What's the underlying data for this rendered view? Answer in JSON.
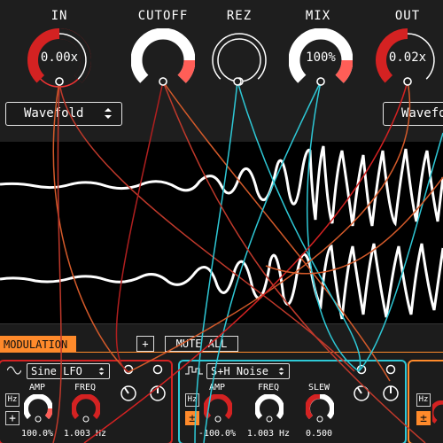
{
  "knobs": [
    {
      "label": "IN",
      "value": "0.00x"
    },
    {
      "label": "CUTOFF",
      "value": ""
    },
    {
      "label": "REZ",
      "value": ""
    },
    {
      "label": "MIX",
      "value": "100%"
    },
    {
      "label": "OUT",
      "value": "0.02x"
    }
  ],
  "selects": {
    "left": "Wavefold",
    "right": "Wavefold"
  },
  "modulation": {
    "tab_label": "MODULATION",
    "add_label": "+",
    "mute_label": "MUTE ALL",
    "mod1": {
      "type": "Sine LFO",
      "params": [
        {
          "label": "AMP",
          "value": "100.0%"
        },
        {
          "label": "FREQ",
          "value": "1.003 Hz"
        }
      ],
      "hz": "Hz",
      "sign": "+"
    },
    "mod2": {
      "type": "S+H Noise",
      "params": [
        {
          "label": "AMP",
          "value": "-100.0%"
        },
        {
          "label": "FREQ",
          "value": "1.003 Hz"
        },
        {
          "label": "SLEW",
          "value": "0.500"
        }
      ],
      "hz": "Hz",
      "sign": "±"
    }
  },
  "colors": {
    "accent": "#ff8a2b",
    "red": "#d42222",
    "salmon": "#ff5e57",
    "cyan": "#2ec8d6",
    "white": "#ffffff"
  }
}
